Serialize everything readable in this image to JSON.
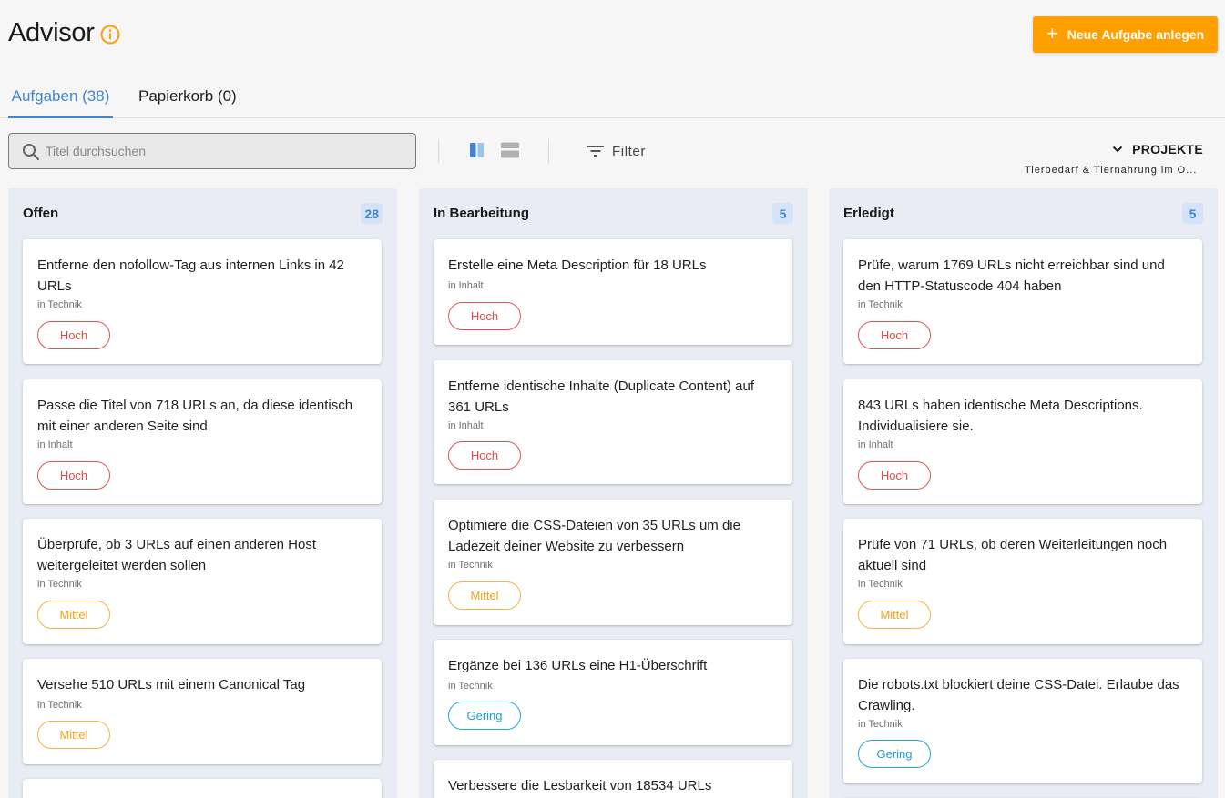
{
  "header": {
    "title": "Advisor",
    "new_task_label": "Neue Aufgabe anlegen"
  },
  "tabs": [
    {
      "label": "Aufgaben (38)",
      "active": true
    },
    {
      "label": "Papierkorb (0)",
      "active": false
    }
  ],
  "toolbar": {
    "search_placeholder": "Titel durchsuchen",
    "filter_label": "Filter",
    "projects_label": "PROJEKTE",
    "projects_value": "Tierbedarf & Tiernahrung im O..."
  },
  "colors": {
    "accent": "#3f86cf",
    "primary_button": "#ffa000",
    "prio_hoch": "#e04a4a",
    "prio_mittel": "#f0a320",
    "prio_gering": "#1ea0cf"
  },
  "columns": [
    {
      "title": "Offen",
      "count": "28",
      "cards": [
        {
          "title": "Entferne den nofollow-Tag aus internen Links in 42 URLs",
          "category": "in Technik",
          "priority": "Hoch"
        },
        {
          "title": "Passe die Titel von 718 URLs an, da diese identisch mit einer anderen Seite sind",
          "category": "in Inhalt",
          "priority": "Hoch"
        },
        {
          "title": "Überprüfe, ob 3 URLs auf einen anderen Host weitergeleitet werden sollen",
          "category": "in Technik",
          "priority": "Mittel"
        },
        {
          "title": "Versehe 510 URLs mit einem Canonical Tag",
          "category": "in Technik",
          "priority": "Mittel"
        }
      ]
    },
    {
      "title": "In Bearbeitung",
      "count": "5",
      "cards": [
        {
          "title": "Erstelle eine Meta Description für 18 URLs",
          "category": "in Inhalt",
          "priority": "Hoch"
        },
        {
          "title": "Entferne identische Inhalte (Duplicate Content) auf 361 URLs",
          "category": "in Inhalt",
          "priority": "Hoch"
        },
        {
          "title": "Optimiere die CSS-Dateien von 35 URLs um die Ladezeit deiner Website zu verbessern",
          "category": "in Technik",
          "priority": "Mittel"
        },
        {
          "title": "Ergänze bei 136 URLs eine H1-Überschrift",
          "category": "in Technik",
          "priority": "Gering"
        },
        {
          "title": "Verbessere die Lesbarkeit von 18534 URLs",
          "category": "",
          "priority": ""
        }
      ]
    },
    {
      "title": "Erledigt",
      "count": "5",
      "cards": [
        {
          "title": "Prüfe, warum 1769 URLs nicht erreichbar sind und den HTTP-Statuscode 404 haben",
          "category": "in Technik",
          "priority": "Hoch"
        },
        {
          "title": "843 URLs haben identische Meta Descriptions. Individualisiere sie.",
          "category": "in Inhalt",
          "priority": "Hoch"
        },
        {
          "title": "Prüfe von 71 URLs, ob deren Weiterleitungen noch aktuell sind",
          "category": "in Technik",
          "priority": "Mittel"
        },
        {
          "title": "Die robots.txt blockiert deine CSS-Datei. Erlaube das Crawling.",
          "category": "in Technik",
          "priority": "Gering"
        }
      ]
    }
  ]
}
